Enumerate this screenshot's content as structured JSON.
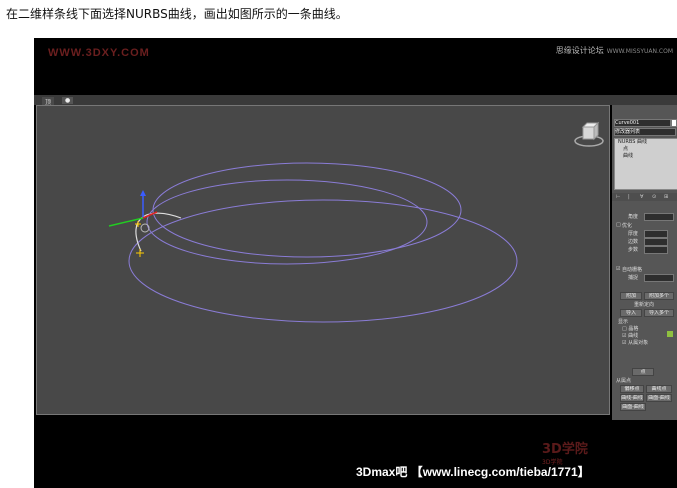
{
  "instruction": "在二维样条线下面选择NURBS曲线，画出如图所示的一条曲线。",
  "watermark": {
    "left": "WWW.3DXY.COM",
    "right": "思缘设计论坛",
    "right_site": "WWW.MISSYUAN.COM"
  },
  "viewport": {
    "label": "顶",
    "shading_button": "●",
    "view_cube_icon": "view-cube"
  },
  "panel": {
    "object_name": "Curve001",
    "modifier_list": "修改器列表",
    "stack": [
      "NURBS 曲线",
      "点",
      "曲线"
    ],
    "sections": {
      "general": "常规",
      "curve_approx": "曲线近似",
      "create_points": "创建点"
    },
    "labels": {
      "steps": "步数",
      "adaptive": "优化",
      "thickness": "厚度",
      "sides": "边数",
      "angle": "角度",
      "auto_grid": "自动栅格",
      "snap": "捕捉",
      "display": "显示",
      "lattices": "晶格",
      "curves": "曲线",
      "dependents": "从属对象",
      "attach": "附加",
      "attach_multiple": "附加多个",
      "reorient": "重新定向",
      "import": "导入",
      "import_multiple": "导入多个",
      "point": "点",
      "dependent_points": "从属点",
      "offset_point": "偏移点",
      "curve_point": "曲线点",
      "curve_curve": "曲线-曲线",
      "surf_curve": "曲面-曲线"
    },
    "tab_colors": [
      "#e07a2e",
      "#5aa0e0",
      "#2f7dd0",
      "#c0c0c0",
      "#d8d8d8",
      "#a0d0ff"
    ]
  },
  "footer": {
    "text": "3Dmax吧 【www.linecg.com/tieba/1771】",
    "logo": "3D学院",
    "logo_sub": "3D学院"
  }
}
